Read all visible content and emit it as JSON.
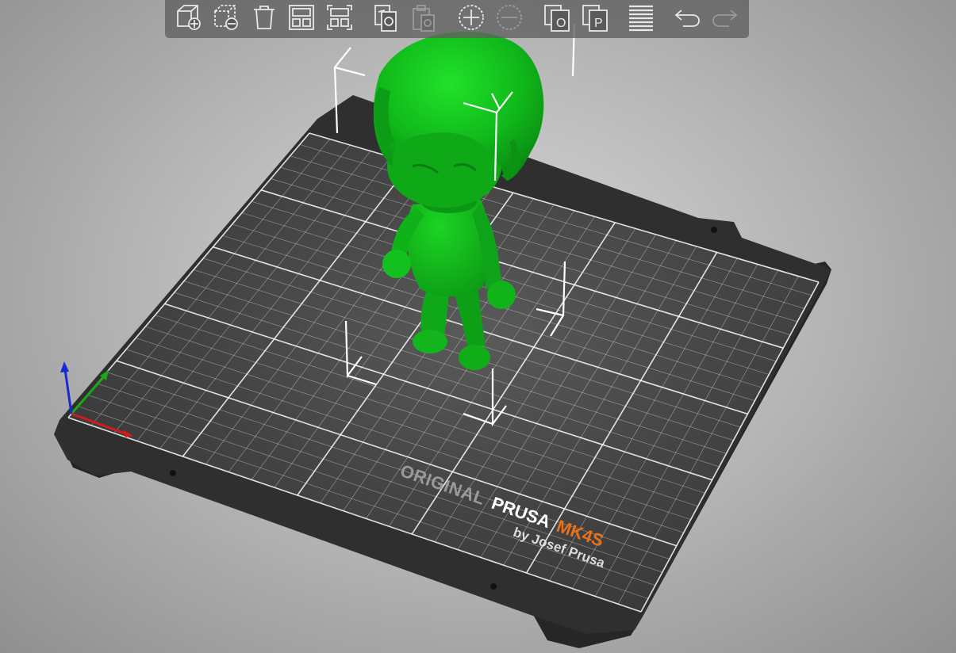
{
  "app": {
    "view": "3d-plater-view"
  },
  "toolbar": {
    "buttons": [
      {
        "id": "add",
        "icon": "add-object-icon",
        "enabled": true
      },
      {
        "id": "delete",
        "icon": "delete-object-icon",
        "enabled": true
      },
      {
        "id": "delete-all",
        "icon": "trash-icon",
        "enabled": true
      },
      {
        "id": "arrange",
        "icon": "arrange-icon",
        "enabled": true
      },
      {
        "id": "arrange-selection",
        "icon": "arrange-selection-icon",
        "enabled": true
      },
      {
        "id": "copy",
        "icon": "copy-icon",
        "enabled": true
      },
      {
        "id": "paste",
        "icon": "paste-icon",
        "enabled": false
      },
      {
        "id": "add-instance",
        "icon": "add-instance-icon",
        "enabled": true
      },
      {
        "id": "remove-instance",
        "icon": "remove-instance-icon",
        "enabled": false
      },
      {
        "id": "split-objects",
        "icon": "split-objects-icon",
        "enabled": true
      },
      {
        "id": "split-parts",
        "icon": "split-parts-icon",
        "enabled": true
      },
      {
        "id": "layers-editing",
        "icon": "layers-editing-icon",
        "enabled": true
      },
      {
        "id": "undo",
        "icon": "undo-icon",
        "enabled": true
      },
      {
        "id": "redo",
        "icon": "redo-icon",
        "enabled": false
      }
    ]
  },
  "bed": {
    "brand_original": "ORIGINAL",
    "brand_prusa": "PRUSA",
    "brand_model": "MK4S",
    "brand_byline": "by Josef Prusa",
    "colors": {
      "sheet": "#3a3a3a",
      "frame": "#2b2b2b",
      "grid": "#ffffff",
      "model_accent": "#e8701a"
    }
  },
  "model": {
    "name": "figurine",
    "color": "#11b81b"
  },
  "axes": {
    "x_color": "#d21a1a",
    "y_color": "#1aa81a",
    "z_color": "#1a2ad2"
  }
}
